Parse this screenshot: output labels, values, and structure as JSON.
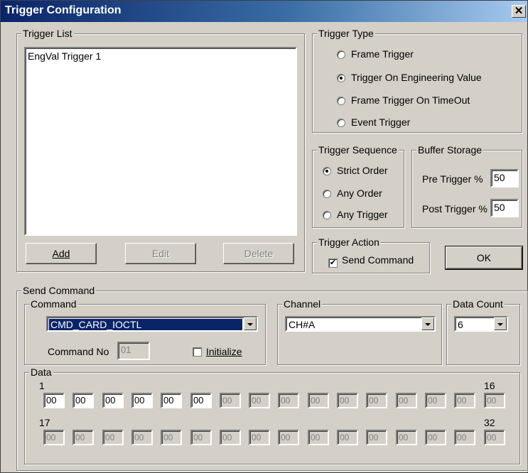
{
  "window": {
    "title": "Trigger Configuration",
    "close_glyph": "✕"
  },
  "trigger_list": {
    "legend": "Trigger List",
    "items": [
      "EngVal Trigger 1"
    ],
    "buttons": {
      "add": {
        "label": "Add",
        "enabled": true
      },
      "edit": {
        "label": "Edit",
        "enabled": false
      },
      "delete": {
        "label": "Delete",
        "enabled": false
      }
    }
  },
  "trigger_type": {
    "legend": "Trigger Type",
    "options": [
      {
        "label": "Frame Trigger",
        "selected": false
      },
      {
        "label": "Trigger On Engineering Value",
        "selected": true
      },
      {
        "label": "Frame Trigger On TimeOut",
        "selected": false
      },
      {
        "label": "Event Trigger",
        "selected": false
      }
    ]
  },
  "trigger_sequence": {
    "legend": "Trigger Sequence",
    "options": [
      {
        "label": "Strict Order",
        "selected": true
      },
      {
        "label": "Any Order",
        "selected": false
      },
      {
        "label": "Any Trigger",
        "selected": false
      }
    ]
  },
  "buffer_storage": {
    "legend": "Buffer Storage",
    "pre_label": "Pre Trigger %",
    "pre_value": "50",
    "post_label": "Post Trigger %",
    "post_value": "50"
  },
  "trigger_action": {
    "legend": "Trigger Action",
    "send_command_label": "Send Command",
    "send_command_checked": true,
    "check_glyph": "✔"
  },
  "ok_label": "OK",
  "send_command": {
    "legend": "Send Command",
    "command": {
      "legend": "Command",
      "selected": "CMD_CARD_IOCTL",
      "command_no_label": "Command No",
      "command_no_value": "01",
      "initialize_label": "Initialize",
      "initialize_checked": false
    },
    "channel": {
      "legend": "Channel",
      "selected": "CH#A"
    },
    "data_count": {
      "legend": "Data Count",
      "selected": "6"
    },
    "data": {
      "legend": "Data",
      "row1_start": "1",
      "row1_end": "16",
      "row2_start": "17",
      "row2_end": "32",
      "row1": [
        "00",
        "00",
        "00",
        "00",
        "00",
        "00",
        "00",
        "00",
        "00",
        "00",
        "00",
        "00",
        "00",
        "00",
        "00",
        "00"
      ],
      "row2": [
        "00",
        "00",
        "00",
        "00",
        "00",
        "00",
        "00",
        "00",
        "00",
        "00",
        "00",
        "00",
        "00",
        "00",
        "00",
        "00"
      ],
      "enabled_count": 6
    }
  }
}
